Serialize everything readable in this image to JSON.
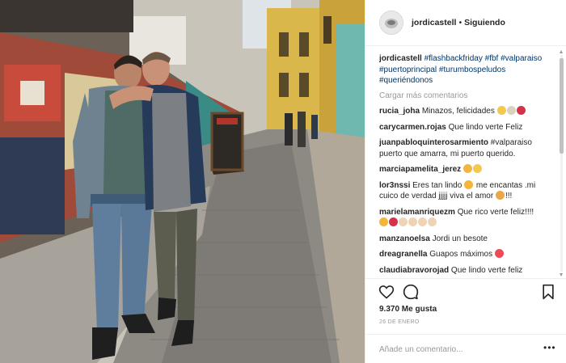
{
  "post": {
    "username": "jordicastell",
    "separator": "•",
    "follow_status": "Siguiendo",
    "caption_user": "jordicastell",
    "caption_text": "#flashbackfriday #fbf #valparaiso #puertoprincipal #turumbospeludos #queriéndonos",
    "load_more": "Cargar más comentarios",
    "likes": "9.370 Me gusta",
    "date": "26 DE ENERO",
    "add_comment_placeholder": "Añade un comentario...",
    "more_options": "•••"
  },
  "comments": [
    {
      "user": "rucia_joha",
      "text": "Minazos, felicidades"
    },
    {
      "user": "carycarmen.rojas",
      "text": "Que lindo verte Feliz"
    },
    {
      "user": "juanpabloquinterosarmiento",
      "text": "#valparaiso puerto que amarra, mi puerto querido."
    },
    {
      "user": "marciapamelita_jerez",
      "text": ""
    },
    {
      "user": "lor3nssi",
      "text": "Eres tan lindo",
      "text2": "me encantas .mi cuico de verdad jjjjj viva el amor",
      "text3": "!!!"
    },
    {
      "user": "marielamanriquezm",
      "text": "Que rico verte feliz!!!!"
    },
    {
      "user": "manzanoelsa",
      "text": "Jordi un besote"
    },
    {
      "user": "dreagranella",
      "text": "Guapos máximos"
    },
    {
      "user": "claudiabravorojad",
      "text": "Que lindo verte feliz"
    }
  ],
  "icons": {
    "like": "heart-icon",
    "comment": "comment-bubble-icon",
    "save": "bookmark-icon",
    "avatar": "user-avatar"
  },
  "colors": {
    "text": "#262626",
    "link": "#003569",
    "muted": "#999999",
    "border": "#efefef"
  }
}
